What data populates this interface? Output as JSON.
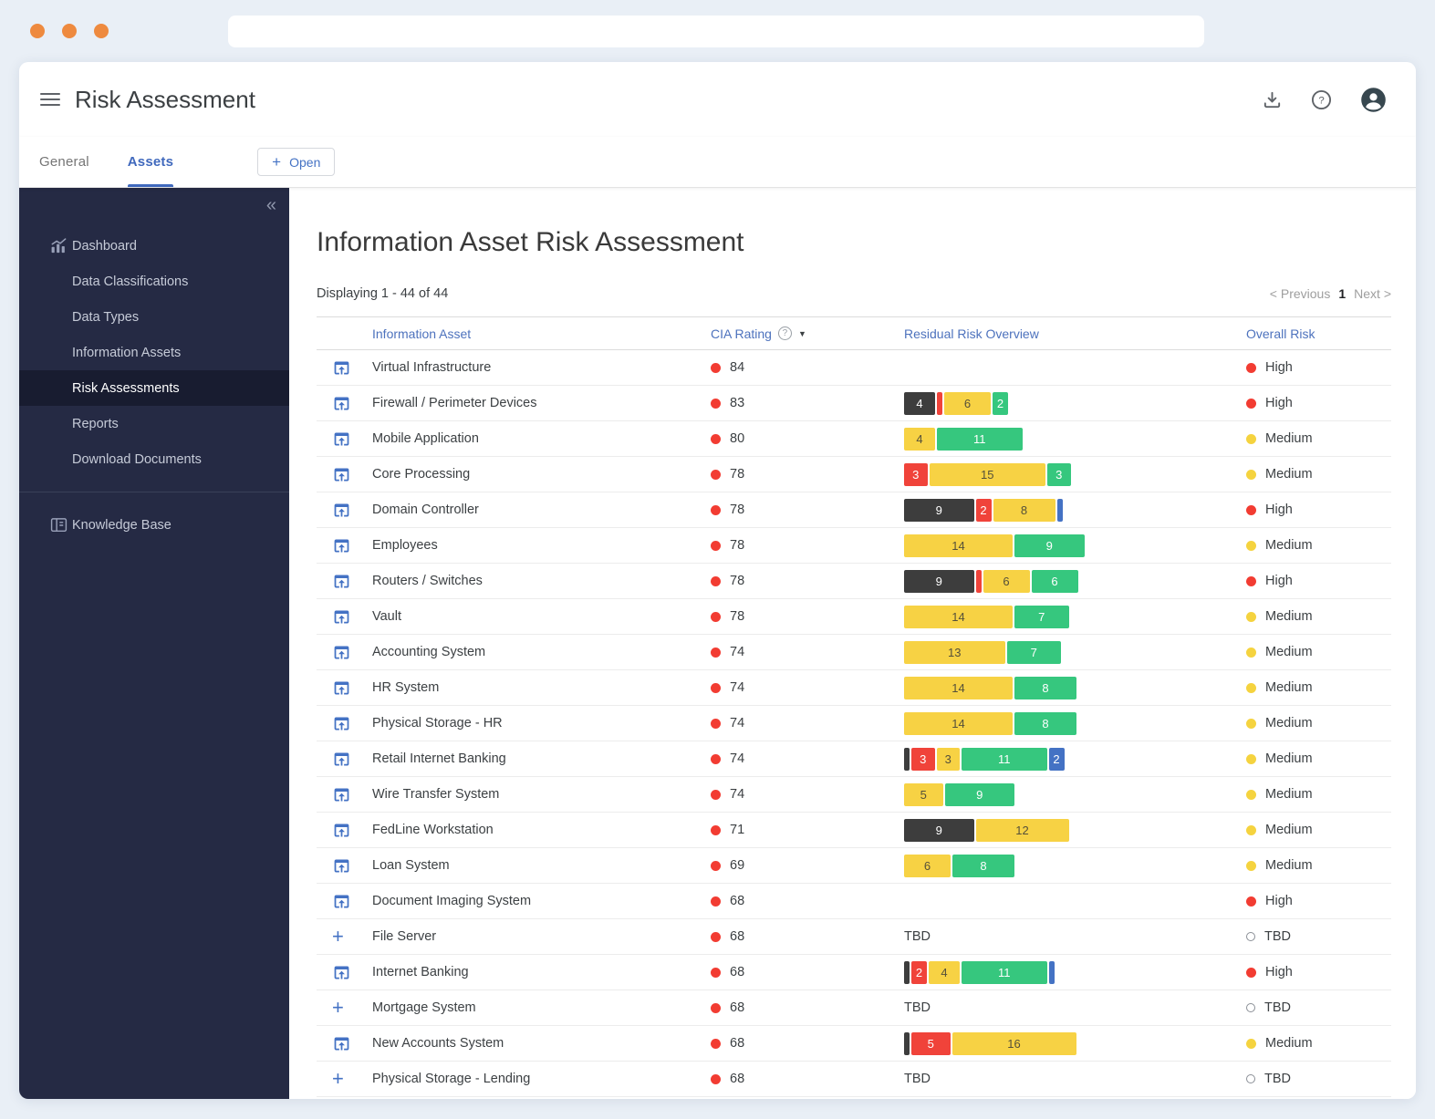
{
  "colors": {
    "accent_blue": "#4472c4",
    "tab_blue": "#4069bd",
    "header_blue": "#4d72bd",
    "bar_black": "#3d3d3d",
    "bar_red": "#f0433a",
    "bar_yellow": "#f7d244",
    "bar_green": "#36c77e",
    "bar_blue": "#4472c4",
    "dot_red": "#f23c32",
    "dot_yellow": "#f5d33f"
  },
  "appbar": {
    "title": "Risk Assessment"
  },
  "tabs": {
    "items": [
      {
        "label": "General",
        "active": false
      },
      {
        "label": "Assets",
        "active": true
      }
    ],
    "open_button": "Open"
  },
  "sidebar": {
    "collapse_icon": "«",
    "items": [
      {
        "label": "Dashboard",
        "icon": "chart-icon"
      },
      {
        "label": "Data Classifications"
      },
      {
        "label": "Data Types"
      },
      {
        "label": "Information Assets"
      },
      {
        "label": "Risk Assessments",
        "active": true
      },
      {
        "label": "Reports"
      },
      {
        "label": "Download Documents"
      }
    ],
    "secondary_items": [
      {
        "label": "Knowledge Base",
        "icon": "book-icon"
      }
    ]
  },
  "main": {
    "title": "Information Asset Risk Assessment",
    "displaying": "Displaying 1 - 44 of 44",
    "pagination": {
      "previous": "< Previous",
      "page": "1",
      "next": "Next >"
    }
  },
  "table": {
    "columns": [
      "Information Asset",
      "CIA Rating",
      "Residual Risk Overview",
      "Overall Risk"
    ],
    "rows": [
      {
        "icon": "open-in-browser-icon",
        "asset": "Virtual Infrastructure",
        "cia_rating": 84,
        "residual": {
          "type": "none"
        },
        "overall_risk": "High"
      },
      {
        "icon": "open-in-browser-icon",
        "asset": "Firewall / Perimeter Devices",
        "cia_rating": 83,
        "residual": {
          "type": "bar",
          "segments": [
            {
              "color": "black",
              "value": 4
            },
            {
              "color": "red"
            },
            {
              "color": "yellow",
              "value": 6
            },
            {
              "color": "green",
              "value": 2
            }
          ]
        },
        "overall_risk": "High"
      },
      {
        "icon": "open-in-browser-icon",
        "asset": "Mobile Application",
        "cia_rating": 80,
        "residual": {
          "type": "bar",
          "segments": [
            {
              "color": "yellow",
              "value": 4
            },
            {
              "color": "green",
              "value": 11
            }
          ]
        },
        "overall_risk": "Medium"
      },
      {
        "icon": "open-in-browser-icon",
        "asset": "Core Processing",
        "cia_rating": 78,
        "residual": {
          "type": "bar",
          "segments": [
            {
              "color": "red",
              "value": 3
            },
            {
              "color": "yellow",
              "value": 15
            },
            {
              "color": "green",
              "value": 3
            }
          ]
        },
        "overall_risk": "Medium"
      },
      {
        "icon": "open-in-browser-icon",
        "asset": "Domain Controller",
        "cia_rating": 78,
        "residual": {
          "type": "bar",
          "segments": [
            {
              "color": "black",
              "value": 9
            },
            {
              "color": "red",
              "value": 2
            },
            {
              "color": "yellow",
              "value": 8
            },
            {
              "color": "blue"
            }
          ]
        },
        "overall_risk": "High"
      },
      {
        "icon": "open-in-browser-icon",
        "asset": "Employees",
        "cia_rating": 78,
        "residual": {
          "type": "bar",
          "segments": [
            {
              "color": "yellow",
              "value": 14
            },
            {
              "color": "green",
              "value": 9
            }
          ]
        },
        "overall_risk": "Medium"
      },
      {
        "icon": "open-in-browser-icon",
        "asset": "Routers / Switches",
        "cia_rating": 78,
        "residual": {
          "type": "bar",
          "segments": [
            {
              "color": "black",
              "value": 9
            },
            {
              "color": "red"
            },
            {
              "color": "yellow",
              "value": 6
            },
            {
              "color": "green",
              "value": 6
            }
          ]
        },
        "overall_risk": "High"
      },
      {
        "icon": "open-in-browser-icon",
        "asset": "Vault",
        "cia_rating": 78,
        "residual": {
          "type": "bar",
          "segments": [
            {
              "color": "yellow",
              "value": 14
            },
            {
              "color": "green",
              "value": 7
            }
          ]
        },
        "overall_risk": "Medium"
      },
      {
        "icon": "open-in-browser-icon",
        "asset": "Accounting System",
        "cia_rating": 74,
        "residual": {
          "type": "bar",
          "segments": [
            {
              "color": "yellow",
              "value": 13
            },
            {
              "color": "green",
              "value": 7
            }
          ]
        },
        "overall_risk": "Medium"
      },
      {
        "icon": "open-in-browser-icon",
        "asset": "HR System",
        "cia_rating": 74,
        "residual": {
          "type": "bar",
          "segments": [
            {
              "color": "yellow",
              "value": 14
            },
            {
              "color": "green",
              "value": 8
            }
          ]
        },
        "overall_risk": "Medium"
      },
      {
        "icon": "open-in-browser-icon",
        "asset": "Physical Storage - HR",
        "cia_rating": 74,
        "residual": {
          "type": "bar",
          "segments": [
            {
              "color": "yellow",
              "value": 14
            },
            {
              "color": "green",
              "value": 8
            }
          ]
        },
        "overall_risk": "Medium"
      },
      {
        "icon": "open-in-browser-icon",
        "asset": "Retail Internet Banking",
        "cia_rating": 74,
        "residual": {
          "type": "bar",
          "segments": [
            {
              "color": "black"
            },
            {
              "color": "red",
              "value": 3
            },
            {
              "color": "yellow",
              "value": 3
            },
            {
              "color": "green",
              "value": 11
            },
            {
              "color": "blue",
              "value": 2
            }
          ]
        },
        "overall_risk": "Medium"
      },
      {
        "icon": "open-in-browser-icon",
        "asset": "Wire Transfer System",
        "cia_rating": 74,
        "residual": {
          "type": "bar",
          "segments": [
            {
              "color": "yellow",
              "value": 5
            },
            {
              "color": "green",
              "value": 9
            }
          ]
        },
        "overall_risk": "Medium"
      },
      {
        "icon": "open-in-browser-icon",
        "asset": "FedLine Workstation",
        "cia_rating": 71,
        "residual": {
          "type": "bar",
          "segments": [
            {
              "color": "black",
              "value": 9
            },
            {
              "color": "yellow",
              "value": 12
            }
          ]
        },
        "overall_risk": "Medium"
      },
      {
        "icon": "open-in-browser-icon",
        "asset": "Loan System",
        "cia_rating": 69,
        "residual": {
          "type": "bar",
          "segments": [
            {
              "color": "yellow",
              "value": 6
            },
            {
              "color": "green",
              "value": 8
            }
          ]
        },
        "overall_risk": "Medium"
      },
      {
        "icon": "open-in-browser-icon",
        "asset": "Document Imaging System",
        "cia_rating": 68,
        "residual": {
          "type": "none"
        },
        "overall_risk": "High"
      },
      {
        "icon": "plus-icon",
        "asset": "File Server",
        "cia_rating": 68,
        "residual": {
          "type": "tbd",
          "label": "TBD"
        },
        "overall_risk": "TBD"
      },
      {
        "icon": "open-in-browser-icon",
        "asset": "Internet Banking",
        "cia_rating": 68,
        "residual": {
          "type": "bar",
          "segments": [
            {
              "color": "black"
            },
            {
              "color": "red",
              "value": 2
            },
            {
              "color": "yellow",
              "value": 4
            },
            {
              "color": "green",
              "value": 11
            },
            {
              "color": "blue"
            }
          ]
        },
        "overall_risk": "High"
      },
      {
        "icon": "plus-icon",
        "asset": "Mortgage System",
        "cia_rating": 68,
        "residual": {
          "type": "tbd",
          "label": "TBD"
        },
        "overall_risk": "TBD"
      },
      {
        "icon": "open-in-browser-icon",
        "asset": "New Accounts System",
        "cia_rating": 68,
        "residual": {
          "type": "bar",
          "segments": [
            {
              "color": "black"
            },
            {
              "color": "red",
              "value": 5
            },
            {
              "color": "yellow",
              "value": 16
            }
          ]
        },
        "overall_risk": "Medium"
      },
      {
        "icon": "plus-icon",
        "asset": "Physical Storage - Lending",
        "cia_rating": 68,
        "residual": {
          "type": "tbd",
          "label": "TBD"
        },
        "overall_risk": "TBD"
      }
    ]
  }
}
